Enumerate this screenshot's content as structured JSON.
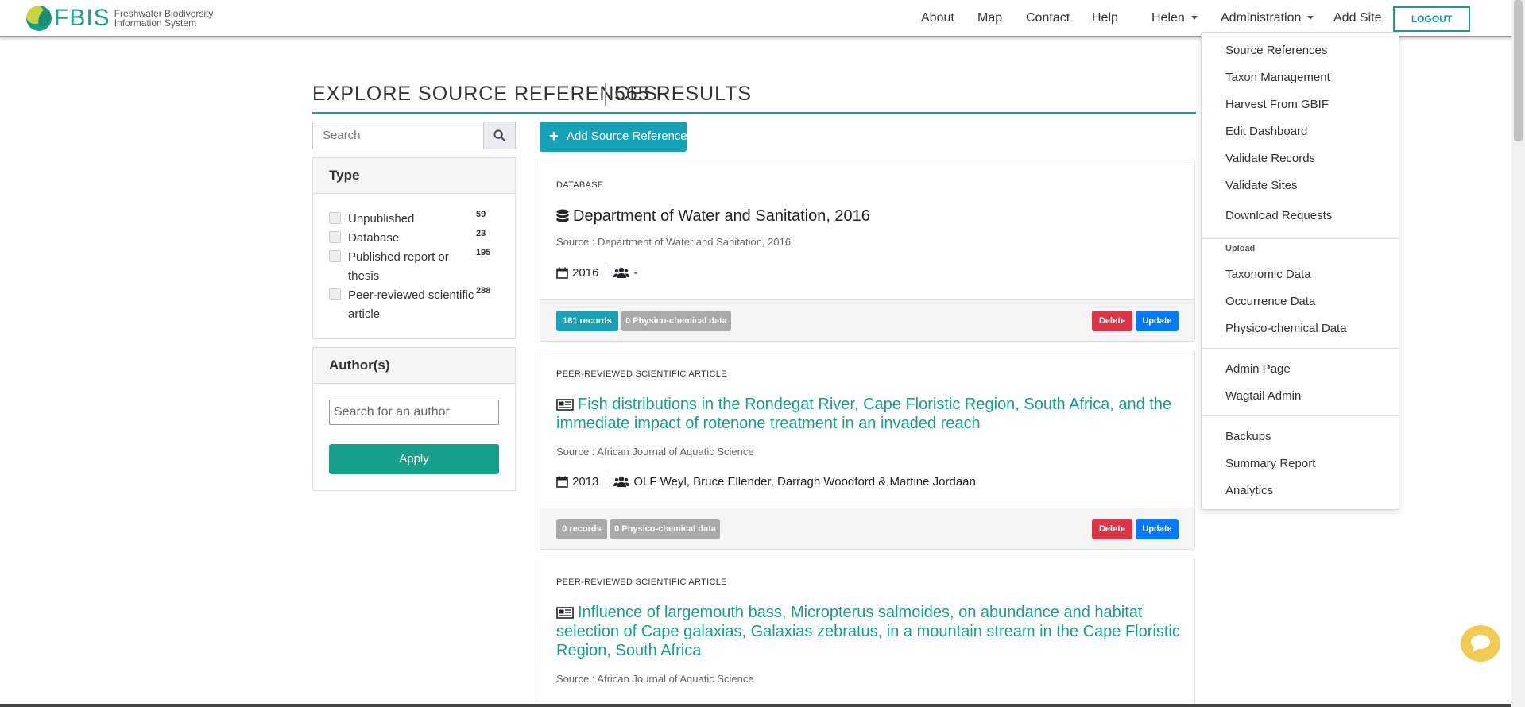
{
  "brand": {
    "name": "FBIS",
    "subtitle": "Freshwater Biodiversity Information System"
  },
  "nav": {
    "about": "About",
    "map": "Map",
    "contact": "Contact",
    "help": "Help",
    "user": "Helen",
    "administration": "Administration",
    "add_site": "Add Site",
    "logout": "LOGOUT"
  },
  "dropdown": {
    "source_references": "Source References",
    "taxon_management": "Taxon Management",
    "harvest_gbif": "Harvest From GBIF",
    "edit_dashboard": "Edit Dashboard",
    "validate_records": "Validate Records",
    "validate_sites": "Validate Sites",
    "download_requests": "Download Requests",
    "upload_header": "Upload",
    "taxonomic_data": "Taxonomic Data",
    "occurrence_data": "Occurrence Data",
    "physico_chemical_data": "Physico-chemical Data",
    "admin_page": "Admin Page",
    "wagtail_admin": "Wagtail Admin",
    "backups": "Backups",
    "summary_report": "Summary Report",
    "analytics": "Analytics"
  },
  "heading": {
    "title": "EXPLORE SOURCE REFERENCES",
    "count": "565 RESULTS"
  },
  "search": {
    "placeholder": "Search"
  },
  "type_filter": {
    "title": "Type",
    "items": [
      {
        "label": "Unpublished",
        "count": "59"
      },
      {
        "label": "Database",
        "count": "23"
      },
      {
        "label": "Published report or thesis",
        "count": "195"
      },
      {
        "label": "Peer-reviewed scientific article",
        "count": "288"
      }
    ]
  },
  "author_filter": {
    "title": "Author(s)",
    "placeholder": "Search for an author",
    "apply": "Apply"
  },
  "add_button": "Add Source Reference",
  "cards": [
    {
      "type": "DATABASE",
      "title": "Department of Water and Sanitation, 2016",
      "source": "Source : Department of Water and Sanitation, 2016",
      "year": "2016",
      "authors": "-",
      "records": "181 records",
      "physico": "0 Physico-chemical data",
      "delete": "Delete",
      "update": "Update"
    },
    {
      "type": "PEER-REVIEWED SCIENTIFIC ARTICLE",
      "title": "Fish distributions in the Rondegat River, Cape Floristic Region, South Africa, and the immediate impact of rotenone treatment in an invaded reach",
      "source": "Source : African Journal of Aquatic Science",
      "year": "2013",
      "authors": "OLF Weyl, Bruce Ellender, Darragh Woodford & Martine Jordaan",
      "records": "0 records",
      "physico": "0 Physico-chemical data",
      "delete": "Delete",
      "update": "Update"
    },
    {
      "type": "PEER-REVIEWED SCIENTIFIC ARTICLE",
      "title": "Influence of largemouth bass, Micropterus salmoides, on abundance and habitat selection of Cape galaxias, Galaxias zebratus, in a mountain stream in the Cape Floristic Region, South Africa",
      "source": "Source : African Journal of Aquatic Science"
    }
  ],
  "colors": {
    "brand_teal": "#17a08a",
    "info": "#17a2b8",
    "danger": "#dc3545",
    "primary": "#007bff",
    "badge_gray": "#aaaaaa",
    "chat": "#f1cb52"
  }
}
